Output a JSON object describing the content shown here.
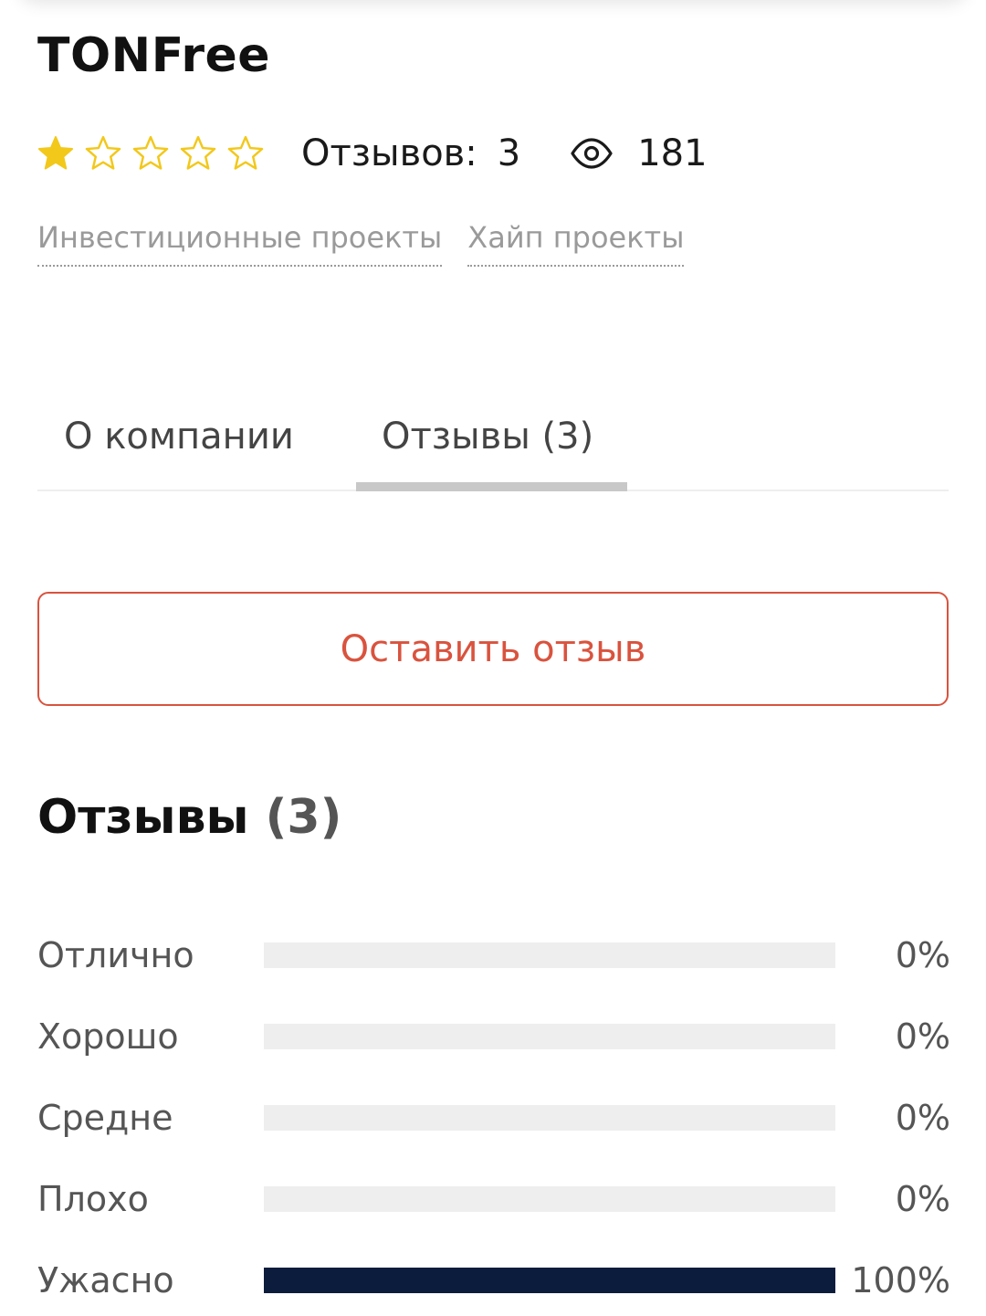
{
  "company": {
    "title": "TONFree"
  },
  "rating": {
    "stars_filled": 1,
    "stars_total": 5,
    "star_color": "#f2c81b",
    "reviews_label": "Отзывов:",
    "reviews_count": "3",
    "views_count": "181"
  },
  "categories": [
    {
      "label": "Инвестиционные проекты"
    },
    {
      "label": "Хайп проекты"
    }
  ],
  "tabs": [
    {
      "label": "О компании",
      "active": false
    },
    {
      "label": "Отзывы (3)",
      "active": true
    }
  ],
  "leave_review": {
    "label": "Оставить отзыв",
    "color": "#d9533e"
  },
  "reviews_section": {
    "title": "Отзывы",
    "count": "(3)"
  },
  "distribution": [
    {
      "label": "Отлично",
      "percent": 0,
      "value_label": "0%"
    },
    {
      "label": "Хорошо",
      "percent": 0,
      "value_label": "0%"
    },
    {
      "label": "Средне",
      "percent": 0,
      "value_label": "0%"
    },
    {
      "label": "Плохо",
      "percent": 0,
      "value_label": "0%"
    },
    {
      "label": "Ужасно",
      "percent": 100,
      "value_label": "100%"
    }
  ],
  "colors": {
    "bar_fill": "#0c1c3d",
    "bar_track": "#eeeeee"
  }
}
